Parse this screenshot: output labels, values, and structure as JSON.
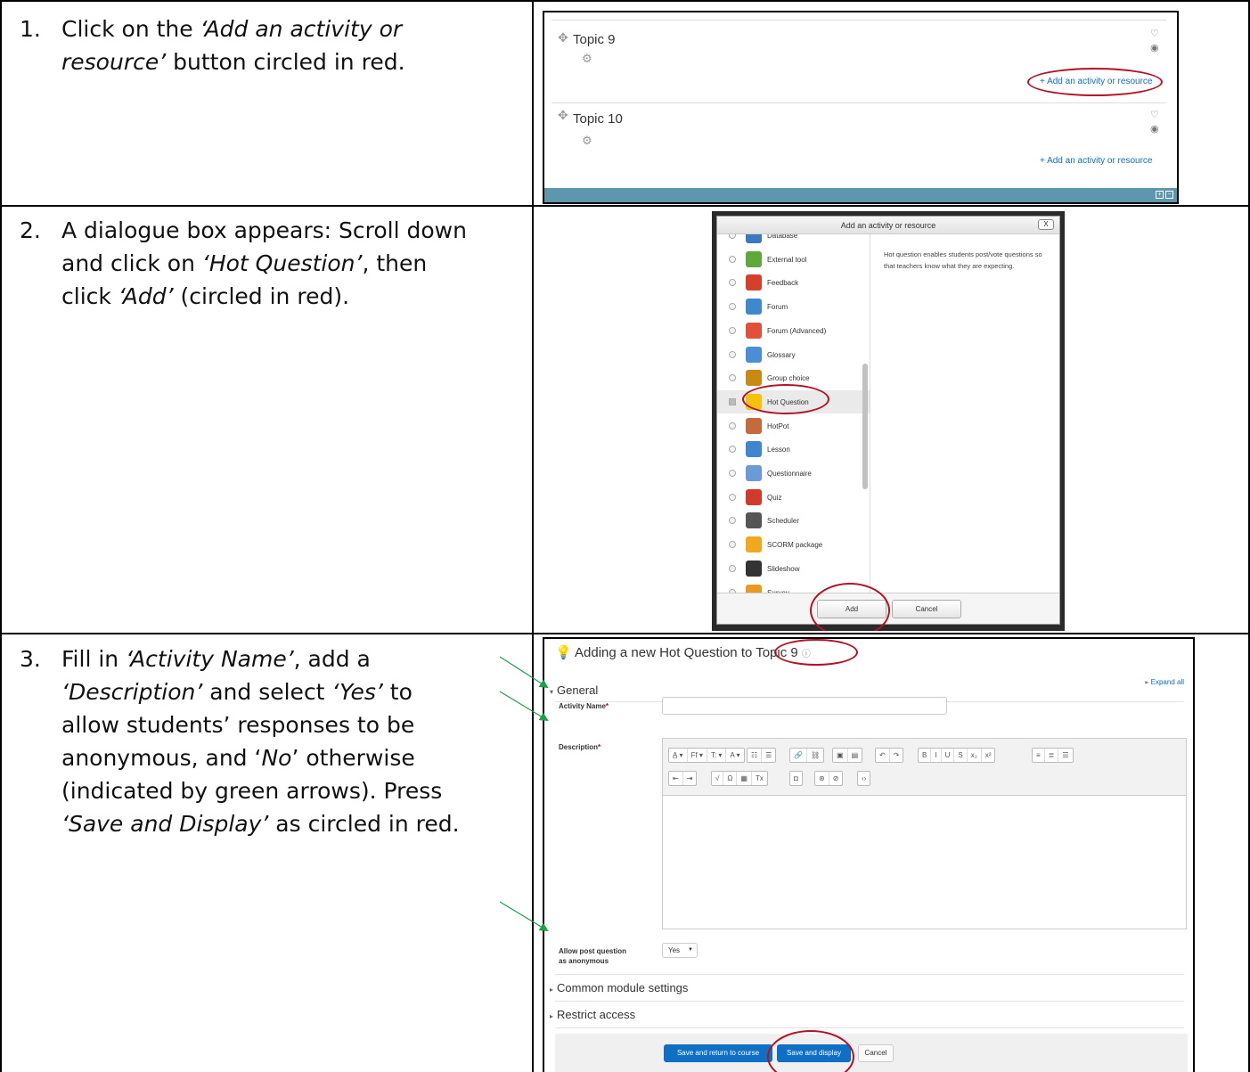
{
  "steps": [
    {
      "number": "1.",
      "lines": [
        [
          {
            "t": "Click on the "
          },
          {
            "t": "‘Add an activity or",
            "i": true
          }
        ],
        [
          {
            "t": "resource’",
            "i": true
          },
          {
            "t": " button circled in red."
          }
        ]
      ]
    },
    {
      "number": "2.",
      "lines": [
        [
          {
            "t": "A dialogue box appears: Scroll down"
          }
        ],
        [
          {
            "t": "and click on "
          },
          {
            "t": "‘Hot Question’",
            "i": true
          },
          {
            "t": ", then"
          }
        ],
        [
          {
            "t": "click "
          },
          {
            "t": "‘Add’",
            "i": true
          },
          {
            "t": " (circled in red)."
          }
        ]
      ]
    },
    {
      "number": "3.",
      "lines": [
        [
          {
            "t": "Fill in "
          },
          {
            "t": "‘Activity Name’",
            "i": true
          },
          {
            "t": ", add a"
          }
        ],
        [
          {
            "t": "‘Description’",
            "i": true
          },
          {
            "t": " and select "
          },
          {
            "t": "‘Yes’",
            "i": true
          },
          {
            "t": " to"
          }
        ],
        [
          {
            "t": "allow students’ responses to be"
          }
        ],
        [
          {
            "t": "anonymous, and ‘"
          },
          {
            "t": "No",
            "i": true
          },
          {
            "t": "’ otherwise"
          }
        ],
        [
          {
            "t": "(indicated by green arrows). Press"
          }
        ],
        [
          {
            "t": "‘Save and Display’",
            "i": true
          },
          {
            "t": " as circled in red."
          }
        ]
      ]
    }
  ],
  "course": {
    "topics": [
      {
        "title": "Topic 9",
        "add_label": "Add an activity or resource"
      },
      {
        "title": "Topic 10",
        "add_label": "Add an activity or resource"
      }
    ]
  },
  "chooser": {
    "title": "Add an activity or resource",
    "close_label": "X",
    "modules": [
      {
        "label": "Database",
        "color": "#3a78c2"
      },
      {
        "label": "External tool",
        "color": "#5fa83c"
      },
      {
        "label": "Feedback",
        "color": "#d6402a"
      },
      {
        "label": "Forum",
        "color": "#3d88cf"
      },
      {
        "label": "Forum (Advanced)",
        "color": "#e0503a"
      },
      {
        "label": "Glossary",
        "color": "#4a8fd6"
      },
      {
        "label": "Group choice",
        "color": "#c98a14"
      },
      {
        "label": "Hot Question",
        "color": "#f4c20d",
        "selected": true
      },
      {
        "label": "HotPot",
        "color": "#c46a3c"
      },
      {
        "label": "Lesson",
        "color": "#3f86d1"
      },
      {
        "label": "Questionnaire",
        "color": "#6a9ad8"
      },
      {
        "label": "Quiz",
        "color": "#d23b2b"
      },
      {
        "label": "Scheduler",
        "color": "#555555"
      },
      {
        "label": "SCORM package",
        "color": "#f0a81c"
      },
      {
        "label": "Slideshow",
        "color": "#333333"
      },
      {
        "label": "Survey",
        "color": "#e89a1c"
      }
    ],
    "description": "Hot question enables students post/vote questions so that teachers know what they are expecting.",
    "add_label": "Add",
    "cancel_label": "Cancel"
  },
  "form": {
    "heading": "Adding a new Hot Question to Topic 9",
    "expand_all": "Expand all",
    "general": "General",
    "activity_name_label": "Activity Name",
    "description_label": "Description",
    "required_marker": "*",
    "toolbar_row1": [
      [
        "A̲ ▾",
        "Ff ▾",
        "T: ▾",
        "A ▾"
      ],
      [
        "☷",
        "☰"
      ],
      [
        "🔗",
        "⛓"
      ],
      [
        "▣",
        "▤"
      ],
      [
        "↶",
        "↷"
      ],
      [
        "B",
        "I",
        "U",
        "S",
        "x₂",
        "x²"
      ],
      [
        "≡",
        "≣",
        "☰"
      ]
    ],
    "toolbar_row2": [
      [
        "⇤",
        "⇥"
      ],
      [
        "√",
        "Ω",
        "▦",
        "Tx"
      ],
      [
        "◘"
      ],
      [
        "⊛",
        "⊘"
      ],
      [
        "‹›"
      ]
    ],
    "anonymous_label_1": "Allow post question",
    "anonymous_label_2": "as anonymous",
    "anonymous_value": "Yes",
    "common_module_settings": "Common module settings",
    "restrict_access": "Restrict access",
    "save_return": "Save and return to course",
    "save_display": "Save and display",
    "cancel": "Cancel"
  },
  "colors": {
    "annotation_circle": "#b11226",
    "annotation_arrow": "#1f9e4a",
    "link": "#0f6fc5",
    "course_footer": "#5e97ad"
  }
}
